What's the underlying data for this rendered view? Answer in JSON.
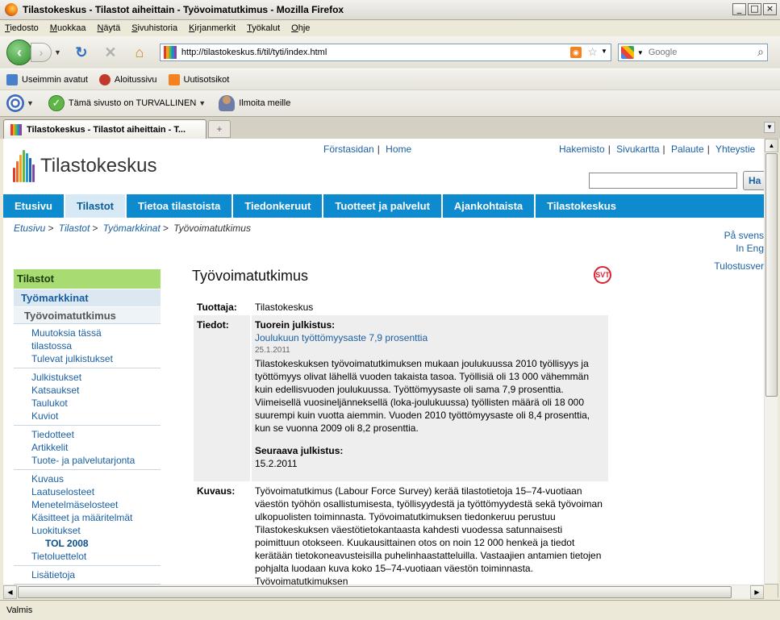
{
  "window": {
    "title": "Tilastokeskus - Tilastot aiheittain - Työvoimatutkimus - Mozilla Firefox"
  },
  "menu": [
    "Tiedosto",
    "Muokkaa",
    "Näytä",
    "Sivuhistoria",
    "Kirjanmerkit",
    "Työkalut",
    "Ohje"
  ],
  "navbar": {
    "url": "http://tilastokeskus.fi/til/tyti/index.html",
    "search_placeholder": "Google"
  },
  "bookmarks": [
    {
      "label": "Useimmin avatut",
      "icon": "search-page-icon"
    },
    {
      "label": "Aloitussivu",
      "icon": "firefox-icon"
    },
    {
      "label": "Uutisotsikot",
      "icon": "rss-icon"
    }
  ],
  "wot": {
    "status": "Tämä sivusto on TURVALLINEN",
    "report": "Ilmoita meille"
  },
  "tab": {
    "label": "Tilastokeskus - Tilastot aiheittain - T...",
    "new_tab": "+"
  },
  "status": "Valmis",
  "page": {
    "logo_text": "Tilastokeskus",
    "toplinks_left": [
      "Förstasidan",
      "Home"
    ],
    "toplinks_right": [
      "Hakemisto",
      "Sivukartta",
      "Palaute",
      "Yhteystie"
    ],
    "search_button": "Ha",
    "nav": [
      {
        "label": "Etusivu",
        "active": false
      },
      {
        "label": "Tilastot",
        "active": true
      },
      {
        "label": "Tietoa tilastoista",
        "active": false
      },
      {
        "label": "Tiedonkeruut",
        "active": false
      },
      {
        "label": "Tuotteet ja palvelut",
        "active": false
      },
      {
        "label": "Ajankohtaista",
        "active": false
      },
      {
        "label": "Tilastokeskus",
        "active": false
      }
    ],
    "breadcrumb": [
      "Etusivu",
      "Tilastot",
      "Työmarkkinat",
      "Työvoimatutkimus"
    ],
    "lang": [
      "På svens",
      "In Eng"
    ],
    "print": "Tulostusver",
    "sidebar": {
      "head": "Tilastot",
      "sub1": "Työmarkkinat",
      "sub2": "Työvoimatutkimus",
      "groups": [
        [
          "Muutoksia tässä",
          "tilastossa",
          "Tulevat julkistukset"
        ],
        [
          "Julkistukset",
          "Katsaukset",
          "Taulukot",
          "Kuviot"
        ],
        [
          "Tiedotteet",
          "Artikkelit",
          "Tuote- ja palvelutarjonta"
        ],
        [
          "Kuvaus",
          "Laatuselosteet",
          "Menetelmäselosteet",
          "Käsitteet ja määritelmät",
          "Luokitukset"
        ],
        [
          "Lisätietoja"
        ]
      ],
      "tol": "TOL 2008",
      "tietoluettelot": "Tietoluettelot"
    },
    "heading": "Työvoimatutkimus",
    "svt": "SVT",
    "rows": {
      "producer_label": "Tuottaja:",
      "producer_value": "Tilastokeskus",
      "info_label": "Tiedot:",
      "latest_title": "Tuorein julkistus:",
      "latest_link": "Joulukuun työttömyysaste 7,9 prosenttia",
      "latest_date": "25.1.2011",
      "latest_text": "Tilastokeskuksen työvoimatutkimuksen mukaan joulukuussa 2010 työllisyys ja työttömyys olivat lähellä vuoden takaista tasoa. Työllisiä oli 13 000 vähemmän kuin edellisvuoden joulukuussa. Työttömyysaste oli sama 7,9 prosenttia. Viimeisellä vuosineljänneksellä (loka-joulukuussa) työllisten määrä oli 18 000 suurempi kuin vuotta aiemmin. Vuoden 2010 työttömyysaste oli 8,4 prosenttia, kun se vuonna 2009 oli 8,2 prosenttia.",
      "next_title": "Seuraava julkistus:",
      "next_date": "15.2.2011",
      "desc_label": "Kuvaus:",
      "desc_text": "Työvoimatutkimus (Labour Force Survey) kerää tilastotietoja 15–74-vuotiaan väestön työhön osallistumisesta, työllisyydestä ja työttömyydestä sekä työvoiman ulkopuolisten toiminnasta. Työvoimatutkimuksen tiedonkeruu perustuu Tilastokeskuksen väestötietokantaasta kahdesti vuodessa satunnaisesti poimittuun otokseen. Kuukausittainen otos on noin 12 000 henkeä ja tiedot kerätään tietokoneavusteisilla puhelinhaastatteluilla. Vastaajien antamien tietojen pohjalta luodaan kuva koko 15–74-vuotiaan väestön toiminnasta. Työvoimatutkimuksen"
    }
  },
  "colors": {
    "nav_blue": "#0e8bcf",
    "sidebar_green": "#a8dc73",
    "link_blue": "#1a5fa3"
  }
}
